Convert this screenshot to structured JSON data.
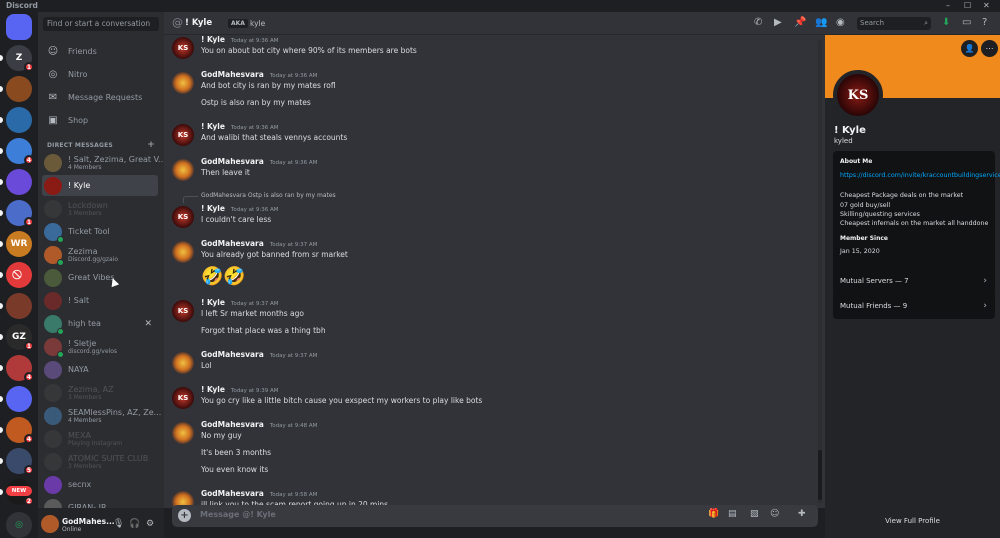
{
  "window": {
    "title": "Discord",
    "controls": [
      "–",
      "☐",
      "✕"
    ]
  },
  "rail": {
    "servers": [
      {
        "label": "",
        "color": "#5865f2",
        "badge": ""
      },
      {
        "label": "Z",
        "color": "#3a3d44",
        "badge": "1"
      },
      {
        "label": "",
        "color": "#8a4a20",
        "badge": ""
      },
      {
        "label": "",
        "color": "#2a6aa8",
        "badge": ""
      },
      {
        "label": "",
        "color": "#3d7ed8",
        "badge": "4"
      },
      {
        "label": "",
        "color": "#6a4ad8",
        "badge": ""
      },
      {
        "label": "",
        "color": "#4b6cc8",
        "badge": "1"
      },
      {
        "label": "WR",
        "color": "#c87b20",
        "badge": ""
      },
      {
        "label": "⃠",
        "color": "#e23a3a",
        "badge": ""
      },
      {
        "label": "",
        "color": "#7a3a2a",
        "badge": ""
      },
      {
        "label": "GZ",
        "color": "#2a2a2a",
        "badge": "1"
      },
      {
        "label": "",
        "color": "#b03a3a",
        "badge": "4"
      },
      {
        "label": "",
        "color": "#5865f2",
        "badge": ""
      },
      {
        "label": "",
        "color": "#c05a20",
        "badge": "4"
      },
      {
        "label": "",
        "color": "#3a4a6a",
        "badge": "5"
      },
      {
        "label": "S",
        "color": "#1a1a1a",
        "badge": "2"
      }
    ],
    "new_label": "NEW"
  },
  "dm": {
    "search_placeholder": "Find or start a conversation",
    "nav": [
      {
        "icon": "friends-icon",
        "glyph": "☺",
        "label": "Friends"
      },
      {
        "icon": "nitro-icon",
        "glyph": "◎",
        "label": "Nitro"
      },
      {
        "icon": "mail-icon",
        "glyph": "✉",
        "label": "Message Requests"
      },
      {
        "icon": "shop-icon",
        "glyph": "▣",
        "label": "Shop"
      }
    ],
    "header": "DIRECT MESSAGES",
    "items": [
      {
        "name": "! Salt, Zezima, Great V...",
        "sub": "4 Members",
        "color": "#6a5a3a",
        "dim": false,
        "sel": false,
        "dot": false
      },
      {
        "name": "! Kyle",
        "sub": "",
        "color": "#8a1a14",
        "dim": false,
        "sel": true,
        "dot": false
      },
      {
        "name": "Lockdown",
        "sub": "3 Members",
        "color": "#4a4a4a",
        "dim": true,
        "sel": false,
        "dot": false
      },
      {
        "name": "Ticket Tool",
        "sub": "",
        "color": "#3a6a9a",
        "dim": false,
        "sel": false,
        "dot": true
      },
      {
        "name": "Zezima",
        "sub": "Discord.gg/gzaio",
        "color": "#b05a2a",
        "dim": false,
        "sel": false,
        "dot": true
      },
      {
        "name": "Great Vibes",
        "sub": "",
        "color": "#4a5a3a",
        "dim": false,
        "sel": false,
        "dot": false
      },
      {
        "name": "! Salt",
        "sub": "",
        "color": "#6a2a2a",
        "dim": false,
        "sel": false,
        "dot": false
      },
      {
        "name": "high tea",
        "sub": "",
        "color": "#3a7a6a",
        "dim": false,
        "sel": false,
        "dot": true,
        "close": "✕"
      },
      {
        "name": "! Sletje",
        "sub": "discord.gg/velos",
        "color": "#7a3a3a",
        "dim": false,
        "sel": false,
        "dot": true
      },
      {
        "name": "NAYA",
        "sub": "",
        "color": "#5a4a7a",
        "dim": false,
        "sel": false,
        "dot": false
      },
      {
        "name": "Zezima, AZ",
        "sub": "3 Members",
        "color": "#4a4a4a",
        "dim": true,
        "sel": false,
        "dot": false
      },
      {
        "name": "SEAMlessPins, AZ, Ze...",
        "sub": "4 Members",
        "color": "#3a5a7a",
        "dim": false,
        "sel": false,
        "dot": false
      },
      {
        "name": "MEXA",
        "sub": "Playing Instagram",
        "color": "#4a4a4a",
        "dim": true,
        "sel": false,
        "dot": false
      },
      {
        "name": "ATOMIC SUITE CLUB",
        "sub": "3 Members",
        "color": "#4a4a4a",
        "dim": true,
        "sel": false,
        "dot": false
      },
      {
        "name": "secnx",
        "sub": "",
        "color": "#6a3aa8",
        "dim": false,
        "sel": false,
        "dot": false
      },
      {
        "name": "GIRAN- JR",
        "sub": "",
        "color": "#5a5a5a",
        "dim": false,
        "sel": false,
        "dot": false
      }
    ]
  },
  "user": {
    "name": "GodMahes...",
    "status": "Online"
  },
  "header": {
    "at": "@",
    "name": "! Kyle",
    "aka_label": "AKA",
    "aka_name": "kyle",
    "search_placeholder": "Search"
  },
  "messages": [
    {
      "author": "! Kyle",
      "time": "Today at 9:36 AM",
      "av": "ks",
      "lines": [
        "You on about bot city where 90% of its members are bots"
      ]
    },
    {
      "author": "GodMahesvara",
      "time": "Today at 9:36 AM",
      "av": "gm",
      "lines": [
        "And bot city is ran by my mates rofl",
        "Ostp is also ran by my mates"
      ]
    },
    {
      "author": "! Kyle",
      "time": "Today at 9:36 AM",
      "av": "ks",
      "lines": [
        "And walibi that steals vennys accounts"
      ]
    },
    {
      "author": "GodMahesvara",
      "time": "Today at 9:36 AM",
      "av": "gm",
      "lines": [
        "Then leave it"
      ]
    },
    {
      "author": "! Kyle",
      "time": "Today at 9:36 AM",
      "av": "ks",
      "reply": "GodMahesvara Ostp is also ran by my mates",
      "lines": [
        "I couldn't care less"
      ]
    },
    {
      "author": "GodMahesvara",
      "time": "Today at 9:37 AM",
      "av": "gm",
      "lines": [
        "You already got banned from sr market",
        "🤣🤣"
      ]
    },
    {
      "author": "! Kyle",
      "time": "Today at 9:37 AM",
      "av": "ks",
      "lines": [
        "I left Sr market months ago",
        "Forgot that place was a thing tbh"
      ]
    },
    {
      "author": "GodMahesvara",
      "time": "Today at 9:37 AM",
      "av": "gm",
      "lines": [
        "Lol"
      ]
    },
    {
      "author": "! Kyle",
      "time": "Today at 9:39 AM",
      "av": "ks",
      "lines": [
        "You go cry like a little bitch cause you exspect my workers to play like bots"
      ]
    },
    {
      "author": "GodMahesvara",
      "time": "Today at 9:48 AM",
      "av": "gm",
      "lines": [
        "No my guy",
        "It's been 3 months",
        "You even know its"
      ]
    },
    {
      "author": "GodMahesvara",
      "time": "Today at 9:58 AM",
      "av": "gm",
      "lines": [
        "ill link you to the scam report going up in 20 mins"
      ]
    }
  ],
  "composer": {
    "placeholder": "Message @! Kyle"
  },
  "profile": {
    "name": "! Kyle",
    "username": "kyled",
    "avatar_text": "KS",
    "about_header": "About Me",
    "about_link": "https://discord.com/invite/kraccountbuildingservices",
    "about_lines": [
      "Cheapest Package deals on the market",
      "07 gold buy/sell",
      "Skilling/questing services",
      "Cheapest infernals on the market all handdone"
    ],
    "since_header": "Member Since",
    "since": "Jan 15, 2020",
    "mutual_servers": "Mutual Servers — 7",
    "mutual_friends": "Mutual Friends — 9",
    "view_full": "View Full Profile"
  }
}
